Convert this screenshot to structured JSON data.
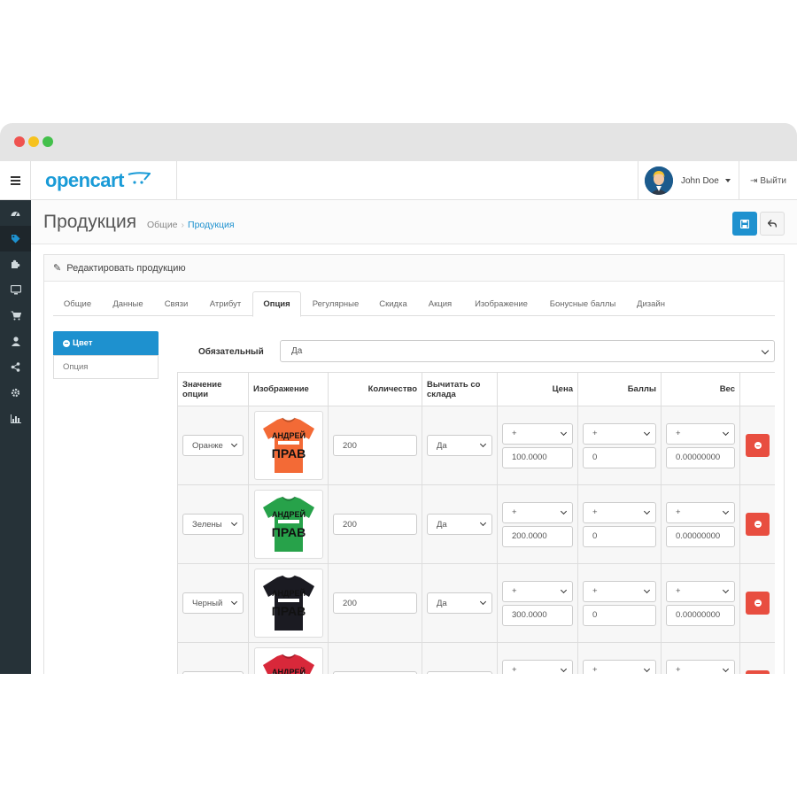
{
  "topbar": {
    "logo": "opencart",
    "user_name": "John Doe",
    "logout_label": "Выйти"
  },
  "sidebar": {
    "items": [
      "dashboard-icon",
      "tag-icon",
      "puzzle-icon",
      "desktop-icon",
      "cart-icon",
      "user-icon",
      "share-icon",
      "gear-icon",
      "chart-icon"
    ],
    "active_index": 1
  },
  "header": {
    "title": "Продукция",
    "breadcrumb": [
      "Общие",
      "Продукция"
    ]
  },
  "panel": {
    "title": "Редактировать продукцию"
  },
  "tabs": [
    "Общие",
    "Данные",
    "Связи",
    "Атрибут",
    "Опция",
    "Регулярные",
    "Скидка",
    "Акция",
    "Изображение",
    "Бонусные баллы",
    "Дизайн"
  ],
  "active_tab": "Опция",
  "options": [
    "Цвет",
    "Опция"
  ],
  "required": {
    "label": "Обязательный",
    "value": "Да"
  },
  "table": {
    "headers": {
      "value": "Значение опции",
      "image": "Изображение",
      "quantity": "Количество",
      "subtract": "Вычитать со склада",
      "price": "Цена",
      "points": "Баллы",
      "weight": "Вес"
    },
    "rows": [
      {
        "value": "Оранже",
        "shirt_color": "#f36a36",
        "text_top": "АНДРЕЙ",
        "text_bottom": "ПРАВ",
        "quantity": "200",
        "subtract": "Да",
        "price_prefix": "+",
        "price": "100.0000",
        "points_prefix": "+",
        "points": "0",
        "weight_prefix": "+",
        "weight": "0.00000000"
      },
      {
        "value": "Зелены",
        "shirt_color": "#27a24a",
        "text_top": "АНДРЕЙ",
        "text_bottom": "ПРАВ",
        "quantity": "200",
        "subtract": "Да",
        "price_prefix": "+",
        "price": "200.0000",
        "points_prefix": "+",
        "points": "0",
        "weight_prefix": "+",
        "weight": "0.00000000"
      },
      {
        "value": "Черный",
        "shirt_color": "#1b1b22",
        "text_top": "АНДРЕЙ",
        "text_bottom": "ПРАВ",
        "quantity": "200",
        "subtract": "Да",
        "price_prefix": "+",
        "price": "300.0000",
        "points_prefix": "+",
        "points": "0",
        "weight_prefix": "+",
        "weight": "0.00000000"
      },
      {
        "value": "",
        "shirt_color": "#d8283a",
        "text_top": "АНДРЕЙ",
        "text_bottom": "",
        "quantity": "",
        "subtract": "",
        "price_prefix": "+",
        "price": "",
        "points_prefix": "+",
        "points": "",
        "weight_prefix": "+",
        "weight": ""
      }
    ]
  },
  "colors": {
    "primary": "#1e91cf",
    "danger": "#e84e40",
    "sidebar_bg": "#263238"
  }
}
